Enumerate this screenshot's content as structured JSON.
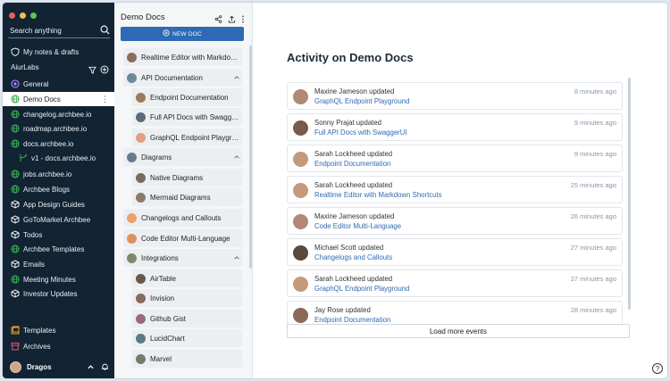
{
  "colors": {
    "sidebar_bg": "#122333",
    "accent": "#2f6ab4",
    "traffic_red": "#ed5f56",
    "traffic_yellow": "#f5bf4f",
    "traffic_green": "#61c454",
    "space_icon": "#37b24d"
  },
  "sidebar": {
    "search_placeholder": "Search anything",
    "my_notes": "My notes & drafts",
    "workspace": "AiurLabs",
    "items": [
      {
        "label": "General",
        "icon": "circle-icon"
      },
      {
        "label": "Demo Docs",
        "icon": "globe-icon",
        "active": true
      },
      {
        "label": "changelog.archbee.io",
        "icon": "globe-icon"
      },
      {
        "label": "roadmap.archbee.io",
        "icon": "globe-icon"
      },
      {
        "label": "docs.archbee.io",
        "icon": "globe-icon"
      },
      {
        "label": "v1 - docs.archbee.io",
        "icon": "version-icon",
        "sub": true
      },
      {
        "label": "jobs.archbee.io",
        "icon": "globe-icon"
      },
      {
        "label": "Archbee Blogs",
        "icon": "globe-icon"
      },
      {
        "label": "App Design Guides",
        "icon": "cube-icon"
      },
      {
        "label": "GoToMarket Archbee",
        "icon": "cube-icon"
      },
      {
        "label": "Todos",
        "icon": "cube-icon"
      },
      {
        "label": "Archbee Templates",
        "icon": "globe-icon"
      },
      {
        "label": "Emails",
        "icon": "cube-icon"
      },
      {
        "label": "Meeting Minutes",
        "icon": "globe-icon"
      },
      {
        "label": "Investor Updates",
        "icon": "cube-icon"
      }
    ],
    "templates": "Templates",
    "archives": "Archives",
    "user": "Dragos"
  },
  "tree": {
    "title": "Demo Docs",
    "new_doc": "NEW DOC",
    "rows": [
      {
        "label": "Realtime Editor with Markdown Shortcuts",
        "level": 0,
        "expand": ""
      },
      {
        "label": "API Documentation",
        "level": 0,
        "expand": "up"
      },
      {
        "label": "Endpoint Documentation",
        "level": 1,
        "expand": ""
      },
      {
        "label": "Full API Docs with SwaggerUI",
        "level": 1,
        "expand": ""
      },
      {
        "label": "GraphQL Endpoint Playground",
        "level": 1,
        "expand": ""
      },
      {
        "label": "Diagrams",
        "level": 0,
        "expand": "up"
      },
      {
        "label": "Native Diagrams",
        "level": 1,
        "expand": ""
      },
      {
        "label": "Mermaid Diagrams",
        "level": 1,
        "expand": ""
      },
      {
        "label": "Changelogs and Callouts",
        "level": 0,
        "expand": ""
      },
      {
        "label": "Code Editor Multi-Language",
        "level": 0,
        "expand": ""
      },
      {
        "label": "Integrations",
        "level": 0,
        "expand": "up"
      },
      {
        "label": "AirTable",
        "level": 1,
        "expand": ""
      },
      {
        "label": "Invision",
        "level": 1,
        "expand": ""
      },
      {
        "label": "Github Gist",
        "level": 1,
        "expand": ""
      },
      {
        "label": "LucidChart",
        "level": 1,
        "expand": ""
      },
      {
        "label": "Marvel",
        "level": 1,
        "expand": ""
      }
    ]
  },
  "main": {
    "title": "Activity on Demo Docs",
    "events": [
      {
        "who": "Maxine Jameson updated",
        "doc": "GraphQL Endpoint Playground",
        "when": "8 minutes ago"
      },
      {
        "who": "Sonny Prajat updated",
        "doc": "Full API Docs with SwaggerUI",
        "when": "9 minutes ago"
      },
      {
        "who": "Sarah Lockheed updated",
        "doc": "Endpoint Documentation",
        "when": "9 minutes ago"
      },
      {
        "who": "Sarah Lockheed updated",
        "doc": "Realtime Editor with Markdown Shortcuts",
        "when": "25 minutes ago"
      },
      {
        "who": "Maxine Jameson updated",
        "doc": "Code Editor Multi-Language",
        "when": "26 minutes ago"
      },
      {
        "who": "Michael Scott updated",
        "doc": "Changelogs and Callouts",
        "when": "27 minutes ago"
      },
      {
        "who": "Sarah Lockheed updated",
        "doc": "GraphQL Endpoint Playground",
        "when": "27 minutes ago"
      },
      {
        "who": "Jay Rose updated",
        "doc": "Endpoint Documentation",
        "when": "28 minutes ago"
      }
    ],
    "load_more": "Load more events",
    "help": "?"
  }
}
